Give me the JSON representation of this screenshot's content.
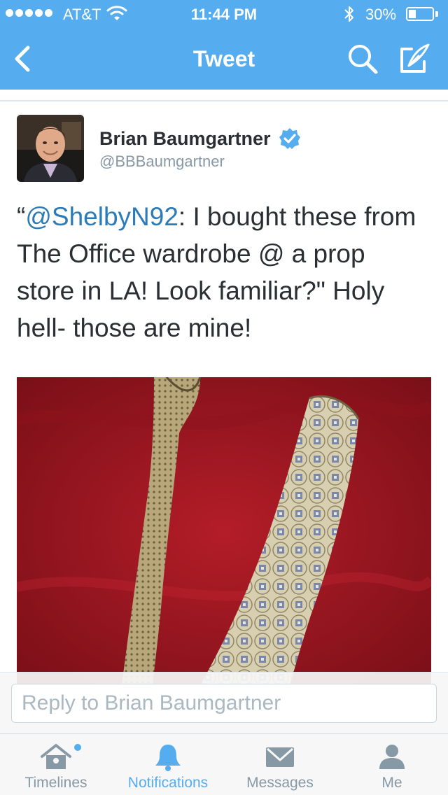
{
  "status_bar": {
    "carrier": "AT&T",
    "time": "11:44 PM",
    "battery_percent": "30%",
    "battery_level": 0.3,
    "signal_bars": 5
  },
  "nav": {
    "title": "Tweet",
    "back_icon": "chevron-left-icon",
    "search_icon": "search-icon",
    "compose_icon": "compose-icon"
  },
  "tweet": {
    "author_name": "Brian Baumgartner",
    "author_handle": "@BBBaumgartner",
    "verified": true,
    "text_open_quote": "“",
    "text_mention": "@ShelbyN92",
    "text_body": ": I bought these from The Office wardrobe @ a prop store in LA! Look familiar?\" Holy hell- those are mine!"
  },
  "reply": {
    "placeholder": "Reply to Brian Baumgartner"
  },
  "tabs": [
    {
      "label": "Timelines",
      "icon": "home-icon",
      "active": false,
      "badge_dot": true
    },
    {
      "label": "Notifications",
      "icon": "bell-icon",
      "active": true,
      "badge_dot": false
    },
    {
      "label": "Messages",
      "icon": "envelope-icon",
      "active": false,
      "badge_dot": false
    },
    {
      "label": "Me",
      "icon": "person-icon",
      "active": false,
      "badge_dot": false
    }
  ],
  "colors": {
    "brand": "#55acee",
    "link": "#2b7bb9",
    "muted": "#8899a6",
    "photo_background": "#a01a24"
  }
}
